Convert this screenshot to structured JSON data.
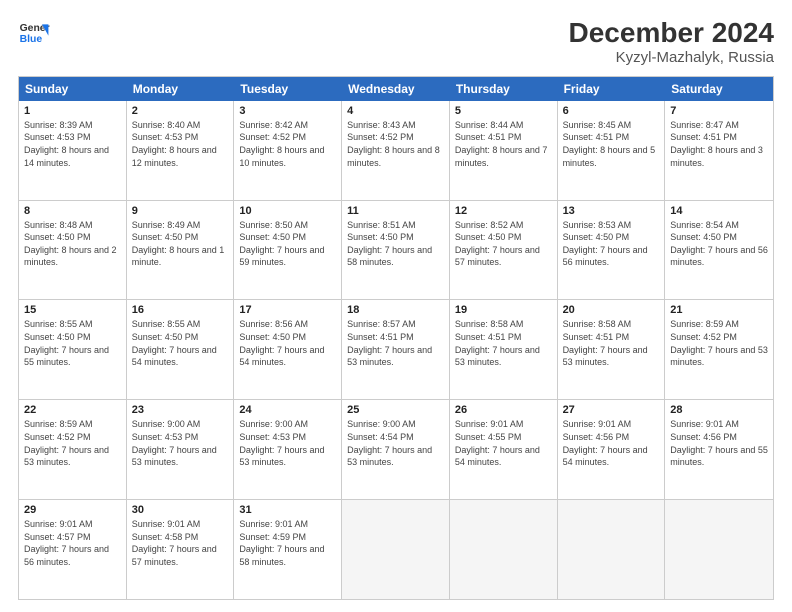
{
  "logo": {
    "line1": "General",
    "line2": "Blue"
  },
  "title": "December 2024",
  "subtitle": "Kyzyl-Mazhalyk, Russia",
  "days": [
    "Sunday",
    "Monday",
    "Tuesday",
    "Wednesday",
    "Thursday",
    "Friday",
    "Saturday"
  ],
  "rows": [
    [
      {
        "day": "1",
        "sunrise": "Sunrise: 8:39 AM",
        "sunset": "Sunset: 4:53 PM",
        "daylight": "Daylight: 8 hours and 14 minutes."
      },
      {
        "day": "2",
        "sunrise": "Sunrise: 8:40 AM",
        "sunset": "Sunset: 4:53 PM",
        "daylight": "Daylight: 8 hours and 12 minutes."
      },
      {
        "day": "3",
        "sunrise": "Sunrise: 8:42 AM",
        "sunset": "Sunset: 4:52 PM",
        "daylight": "Daylight: 8 hours and 10 minutes."
      },
      {
        "day": "4",
        "sunrise": "Sunrise: 8:43 AM",
        "sunset": "Sunset: 4:52 PM",
        "daylight": "Daylight: 8 hours and 8 minutes."
      },
      {
        "day": "5",
        "sunrise": "Sunrise: 8:44 AM",
        "sunset": "Sunset: 4:51 PM",
        "daylight": "Daylight: 8 hours and 7 minutes."
      },
      {
        "day": "6",
        "sunrise": "Sunrise: 8:45 AM",
        "sunset": "Sunset: 4:51 PM",
        "daylight": "Daylight: 8 hours and 5 minutes."
      },
      {
        "day": "7",
        "sunrise": "Sunrise: 8:47 AM",
        "sunset": "Sunset: 4:51 PM",
        "daylight": "Daylight: 8 hours and 3 minutes."
      }
    ],
    [
      {
        "day": "8",
        "sunrise": "Sunrise: 8:48 AM",
        "sunset": "Sunset: 4:50 PM",
        "daylight": "Daylight: 8 hours and 2 minutes."
      },
      {
        "day": "9",
        "sunrise": "Sunrise: 8:49 AM",
        "sunset": "Sunset: 4:50 PM",
        "daylight": "Daylight: 8 hours and 1 minute."
      },
      {
        "day": "10",
        "sunrise": "Sunrise: 8:50 AM",
        "sunset": "Sunset: 4:50 PM",
        "daylight": "Daylight: 7 hours and 59 minutes."
      },
      {
        "day": "11",
        "sunrise": "Sunrise: 8:51 AM",
        "sunset": "Sunset: 4:50 PM",
        "daylight": "Daylight: 7 hours and 58 minutes."
      },
      {
        "day": "12",
        "sunrise": "Sunrise: 8:52 AM",
        "sunset": "Sunset: 4:50 PM",
        "daylight": "Daylight: 7 hours and 57 minutes."
      },
      {
        "day": "13",
        "sunrise": "Sunrise: 8:53 AM",
        "sunset": "Sunset: 4:50 PM",
        "daylight": "Daylight: 7 hours and 56 minutes."
      },
      {
        "day": "14",
        "sunrise": "Sunrise: 8:54 AM",
        "sunset": "Sunset: 4:50 PM",
        "daylight": "Daylight: 7 hours and 56 minutes."
      }
    ],
    [
      {
        "day": "15",
        "sunrise": "Sunrise: 8:55 AM",
        "sunset": "Sunset: 4:50 PM",
        "daylight": "Daylight: 7 hours and 55 minutes."
      },
      {
        "day": "16",
        "sunrise": "Sunrise: 8:55 AM",
        "sunset": "Sunset: 4:50 PM",
        "daylight": "Daylight: 7 hours and 54 minutes."
      },
      {
        "day": "17",
        "sunrise": "Sunrise: 8:56 AM",
        "sunset": "Sunset: 4:50 PM",
        "daylight": "Daylight: 7 hours and 54 minutes."
      },
      {
        "day": "18",
        "sunrise": "Sunrise: 8:57 AM",
        "sunset": "Sunset: 4:51 PM",
        "daylight": "Daylight: 7 hours and 53 minutes."
      },
      {
        "day": "19",
        "sunrise": "Sunrise: 8:58 AM",
        "sunset": "Sunset: 4:51 PM",
        "daylight": "Daylight: 7 hours and 53 minutes."
      },
      {
        "day": "20",
        "sunrise": "Sunrise: 8:58 AM",
        "sunset": "Sunset: 4:51 PM",
        "daylight": "Daylight: 7 hours and 53 minutes."
      },
      {
        "day": "21",
        "sunrise": "Sunrise: 8:59 AM",
        "sunset": "Sunset: 4:52 PM",
        "daylight": "Daylight: 7 hours and 53 minutes."
      }
    ],
    [
      {
        "day": "22",
        "sunrise": "Sunrise: 8:59 AM",
        "sunset": "Sunset: 4:52 PM",
        "daylight": "Daylight: 7 hours and 53 minutes."
      },
      {
        "day": "23",
        "sunrise": "Sunrise: 9:00 AM",
        "sunset": "Sunset: 4:53 PM",
        "daylight": "Daylight: 7 hours and 53 minutes."
      },
      {
        "day": "24",
        "sunrise": "Sunrise: 9:00 AM",
        "sunset": "Sunset: 4:53 PM",
        "daylight": "Daylight: 7 hours and 53 minutes."
      },
      {
        "day": "25",
        "sunrise": "Sunrise: 9:00 AM",
        "sunset": "Sunset: 4:54 PM",
        "daylight": "Daylight: 7 hours and 53 minutes."
      },
      {
        "day": "26",
        "sunrise": "Sunrise: 9:01 AM",
        "sunset": "Sunset: 4:55 PM",
        "daylight": "Daylight: 7 hours and 54 minutes."
      },
      {
        "day": "27",
        "sunrise": "Sunrise: 9:01 AM",
        "sunset": "Sunset: 4:56 PM",
        "daylight": "Daylight: 7 hours and 54 minutes."
      },
      {
        "day": "28",
        "sunrise": "Sunrise: 9:01 AM",
        "sunset": "Sunset: 4:56 PM",
        "daylight": "Daylight: 7 hours and 55 minutes."
      }
    ],
    [
      {
        "day": "29",
        "sunrise": "Sunrise: 9:01 AM",
        "sunset": "Sunset: 4:57 PM",
        "daylight": "Daylight: 7 hours and 56 minutes."
      },
      {
        "day": "30",
        "sunrise": "Sunrise: 9:01 AM",
        "sunset": "Sunset: 4:58 PM",
        "daylight": "Daylight: 7 hours and 57 minutes."
      },
      {
        "day": "31",
        "sunrise": "Sunrise: 9:01 AM",
        "sunset": "Sunset: 4:59 PM",
        "daylight": "Daylight: 7 hours and 58 minutes."
      },
      null,
      null,
      null,
      null
    ]
  ]
}
